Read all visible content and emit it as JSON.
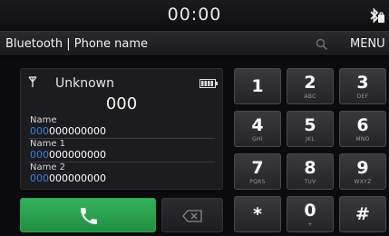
{
  "status": {
    "time": "00:00",
    "icon": "bluetooth-status-icon"
  },
  "header": {
    "title": "Bluetooth | Phone name",
    "menu_label": "MENU",
    "search_icon": "search-icon"
  },
  "caller": {
    "name": "Unknown",
    "number": "000"
  },
  "contacts": [
    {
      "name": "Name",
      "number_prefix": "000",
      "number_rest": "000000000"
    },
    {
      "name": "Name 1",
      "number_prefix": "000",
      "number_rest": "000000000"
    },
    {
      "name": "Name 2",
      "number_prefix": "000",
      "number_rest": "000000000"
    }
  ],
  "actions": {
    "call_icon": "phone-icon",
    "backspace_icon": "backspace-icon",
    "call_color": "#22a04a"
  },
  "keypad": [
    {
      "digit": "1",
      "letters": ""
    },
    {
      "digit": "2",
      "letters": "ABC"
    },
    {
      "digit": "3",
      "letters": "DEF"
    },
    {
      "digit": "4",
      "letters": "GHI"
    },
    {
      "digit": "5",
      "letters": "JKL"
    },
    {
      "digit": "6",
      "letters": "MNO"
    },
    {
      "digit": "7",
      "letters": "PQRS"
    },
    {
      "digit": "8",
      "letters": "TUV"
    },
    {
      "digit": "9",
      "letters": "WXYZ"
    },
    {
      "digit": "*",
      "letters": ""
    },
    {
      "digit": "0",
      "letters": "+"
    },
    {
      "digit": "#",
      "letters": ""
    }
  ]
}
